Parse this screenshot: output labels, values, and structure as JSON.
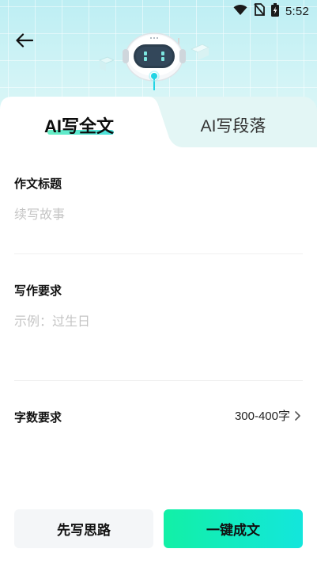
{
  "status_bar": {
    "time": "5:52",
    "icons": [
      "wifi-icon",
      "no-sim-icon",
      "battery-charging-icon"
    ]
  },
  "header": {
    "back_icon": "arrow-left-icon",
    "mascot": "robot-mascot"
  },
  "tabs": [
    {
      "label": "AI写全文",
      "active": true
    },
    {
      "label": "AI写段落",
      "active": false
    }
  ],
  "form": {
    "title_field": {
      "label": "作文标题",
      "value": "",
      "placeholder": "续写故事"
    },
    "requirement_field": {
      "label": "写作要求",
      "value": "",
      "placeholder": "示例：过生日"
    },
    "word_count": {
      "label": "字数要求",
      "value": "300-400字",
      "icon": "chevron-right-icon"
    }
  },
  "buttons": {
    "outline_label": "先写思路",
    "primary_label": "一键成文"
  },
  "colors": {
    "accent_start": "#12f0a6",
    "accent_end": "#13e6dc",
    "header_bg": "#bdeef3",
    "placeholder": "#c4c4c4"
  }
}
